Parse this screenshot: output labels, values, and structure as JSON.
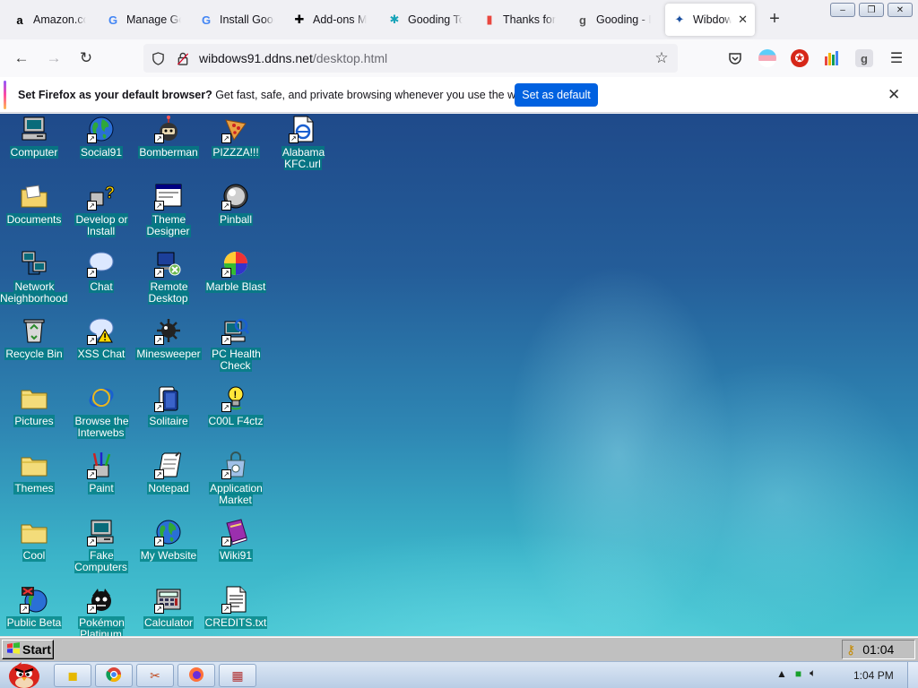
{
  "browser": {
    "tabs": [
      {
        "label": "Amazon.co",
        "favicon": "a",
        "icon": "amazon-icon"
      },
      {
        "label": "Manage Go",
        "favicon": "G",
        "icon": "google-icon"
      },
      {
        "label": "Install Goog",
        "favicon": "G",
        "icon": "google-icon"
      },
      {
        "label": "Add-ons M",
        "favicon": "✚",
        "icon": "puzzle-icon"
      },
      {
        "label": "Gooding To",
        "favicon": "✱",
        "icon": "gooding-icon"
      },
      {
        "label": "Thanks for",
        "favicon": "▮",
        "icon": "bars-icon"
      },
      {
        "label": "Gooding - D",
        "favicon": "g",
        "icon": "gooding-g-icon"
      },
      {
        "label": "Wibdows",
        "favicon": "✦",
        "icon": "windows-flag-icon",
        "active": true
      }
    ],
    "new_tab_glyph": "+",
    "window_controls": [
      "–",
      "❐",
      "✕"
    ],
    "url": {
      "host": "wibdows91.ddns.net",
      "path": "/desktop.html"
    }
  },
  "notification": {
    "bold": "Set Firefox as your default browser?",
    "text": " Get fast, safe, and private browsing whenever you use the web.",
    "button": "Set as default"
  },
  "desktop": {
    "icons": [
      {
        "label": "Computer",
        "icon": "computer-icon",
        "shortcut": false
      },
      {
        "label": "Social91",
        "icon": "globe-icon",
        "shortcut": true
      },
      {
        "label": "Bomberman",
        "icon": "bomberman-icon",
        "shortcut": true
      },
      {
        "label": "PIZZZA!!!",
        "icon": "pizza-icon",
        "shortcut": true
      },
      {
        "label": "Alabama KFC.url",
        "icon": "internet-shortcut-icon",
        "shortcut": true
      },
      {
        "label": "Documents",
        "icon": "documents-folder-icon",
        "shortcut": false
      },
      {
        "label": "Develop or Install",
        "icon": "help-icon",
        "shortcut": true
      },
      {
        "label": "Theme Designer",
        "icon": "window-icon",
        "shortcut": true
      },
      {
        "label": "Pinball",
        "icon": "pinball-icon",
        "shortcut": true
      },
      {
        "label": "Network Neighborhood",
        "icon": "network-icon",
        "shortcut": false
      },
      {
        "label": "Chat",
        "icon": "chat-bubble-icon",
        "shortcut": true
      },
      {
        "label": "Remote Desktop",
        "icon": "remote-desktop-icon",
        "shortcut": true
      },
      {
        "label": "Marble Blast",
        "icon": "marble-icon",
        "shortcut": true
      },
      {
        "label": "Recycle Bin",
        "icon": "recycle-bin-icon",
        "shortcut": false
      },
      {
        "label": "XSS Chat",
        "icon": "warning-chat-icon",
        "shortcut": true
      },
      {
        "label": "Minesweeper",
        "icon": "mine-icon",
        "shortcut": true
      },
      {
        "label": "PC Health Check",
        "icon": "health-check-icon",
        "shortcut": true
      },
      {
        "label": "Pictures",
        "icon": "folder-icon",
        "shortcut": false
      },
      {
        "label": "Browse the Interwebs",
        "icon": "ie-icon",
        "shortcut": false
      },
      {
        "label": "Solitaire",
        "icon": "cards-icon",
        "shortcut": true
      },
      {
        "label": "C00L F4ctz",
        "icon": "bulb-icon",
        "shortcut": true
      },
      {
        "label": "Themes",
        "icon": "folder-icon",
        "shortcut": false
      },
      {
        "label": "Paint",
        "icon": "paint-icon",
        "shortcut": true
      },
      {
        "label": "Notepad",
        "icon": "notepad-icon",
        "shortcut": true
      },
      {
        "label": "Application Market",
        "icon": "market-bag-icon",
        "shortcut": true
      },
      {
        "label": "Cool",
        "icon": "folder-icon",
        "shortcut": false
      },
      {
        "label": "Fake Computers",
        "icon": "computer-icon",
        "shortcut": true
      },
      {
        "label": "My Website",
        "icon": "globe-icon",
        "shortcut": true
      },
      {
        "label": "Wiki91",
        "icon": "book-icon",
        "shortcut": true
      },
      {
        "label": "Public Beta",
        "icon": "beta-globe-icon",
        "shortcut": true
      },
      {
        "label": "Pokémon Platinum",
        "icon": "pokemon-icon",
        "shortcut": true
      },
      {
        "label": "Calculator",
        "icon": "calculator-icon",
        "shortcut": true
      },
      {
        "label": "CREDITS.txt",
        "icon": "text-file-icon",
        "shortcut": true
      }
    ]
  },
  "win95_taskbar": {
    "start_label": "Start",
    "clock": "01:04"
  },
  "win7_taskbar": {
    "pinned": [
      "folder-icon",
      "chrome-icon",
      "media-player-icon",
      "firefox-icon",
      "tool-icon"
    ],
    "clock": "1:04 PM"
  },
  "colors": {
    "accent": "#0061e0",
    "desktop_top": "#1f4a8a",
    "desktop_bottom": "#48c6d2",
    "label_bg": "#008080"
  }
}
